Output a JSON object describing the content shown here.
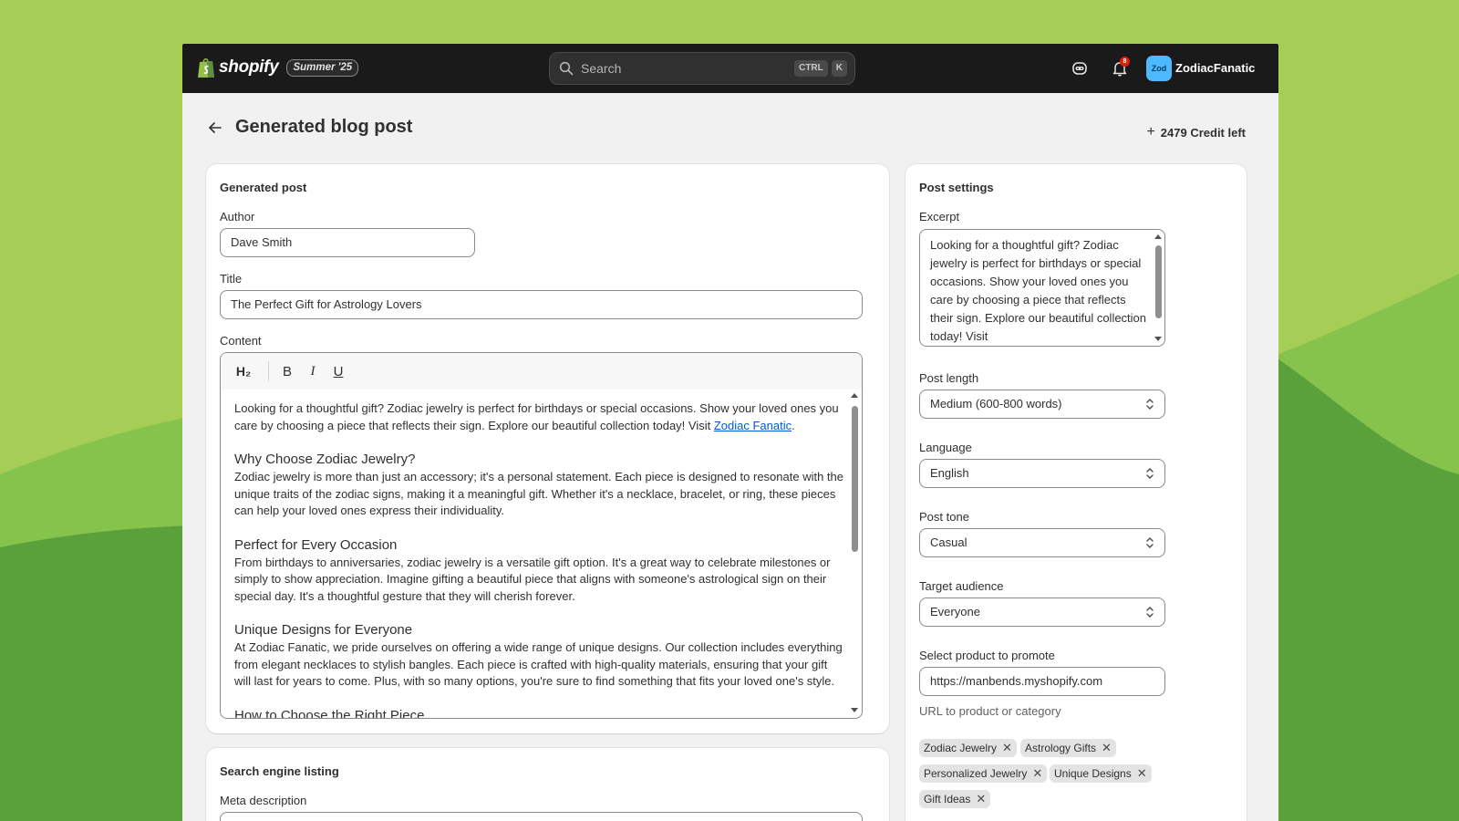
{
  "topbar": {
    "brand": "shopify",
    "edition": "Summer '25",
    "search_placeholder": "Search",
    "shortcut_keys": [
      "CTRL",
      "K"
    ],
    "notification_count": "8",
    "avatar_initials": "Zod",
    "store_name": "ZodiacFanatic"
  },
  "page": {
    "title": "Generated blog post",
    "credits": "2479 Credit left"
  },
  "generated_post": {
    "card_title": "Generated post",
    "author_label": "Author",
    "author_value": "Dave Smith",
    "title_label": "Title",
    "title_value": "The Perfect Gift for Astrology Lovers",
    "content_label": "Content",
    "toolbar": {
      "h2": "H₂",
      "bold": "B",
      "italic": "I",
      "underline": "U"
    },
    "content": {
      "intro": "Looking for a thoughtful gift? Zodiac jewelry is perfect for birthdays or special occasions. Show your loved ones you care by choosing a piece that reflects their sign. Explore our beautiful collection today! Visit ",
      "intro_link": "Zodiac Fanatic",
      "intro_end": ".",
      "sections": [
        {
          "heading": "Why Choose Zodiac Jewelry?",
          "body": "Zodiac jewelry is more than just an accessory; it's a personal statement. Each piece is designed to resonate with the unique traits of the zodiac signs, making it a meaningful gift. Whether it's a necklace, bracelet, or ring, these pieces can help your loved ones express their individuality."
        },
        {
          "heading": "Perfect for Every Occasion",
          "body": "From birthdays to anniversaries, zodiac jewelry is a versatile gift option. It's a great way to celebrate milestones or simply to show appreciation. Imagine gifting a beautiful piece that aligns with someone's astrological sign on their special day. It's a thoughtful gesture that they will cherish forever."
        },
        {
          "heading": "Unique Designs for Everyone",
          "body": "At Zodiac Fanatic, we pride ourselves on offering a wide range of unique designs. Our collection includes everything from elegant necklaces to stylish bangles. Each piece is crafted with high-quality materials, ensuring that your gift will last for years to come. Plus, with so many options, you're sure to find something that fits your loved one's style."
        },
        {
          "heading": "How to Choose the Right Piece",
          "body": ""
        }
      ]
    }
  },
  "seo": {
    "card_title": "Search engine listing",
    "meta_label": "Meta description"
  },
  "settings": {
    "card_title": "Post settings",
    "excerpt_label": "Excerpt",
    "excerpt_value": "Looking for a thoughtful gift? Zodiac jewelry is perfect for birthdays or special occasions. Show your loved ones you care by choosing a piece that reflects their sign. Explore our beautiful collection today! Visit",
    "post_length_label": "Post length",
    "post_length_value": "Medium (600-800 words)",
    "language_label": "Language",
    "language_value": "English",
    "tone_label": "Post tone",
    "tone_value": "Casual",
    "audience_label": "Target audience",
    "audience_value": "Everyone",
    "product_label": "Select product to promote",
    "product_value": "https://manbends.myshopify.com",
    "product_help": "URL to product or category",
    "tags": [
      "Zodiac Jewelry",
      "Astrology Gifts",
      "Personalized Jewelry",
      "Unique Designs",
      "Gift Ideas"
    ]
  },
  "colors": {
    "background_green": "#8cc152",
    "topbar": "#1a1a1a",
    "link": "#005bd3",
    "avatar": "#4fb9ff"
  }
}
